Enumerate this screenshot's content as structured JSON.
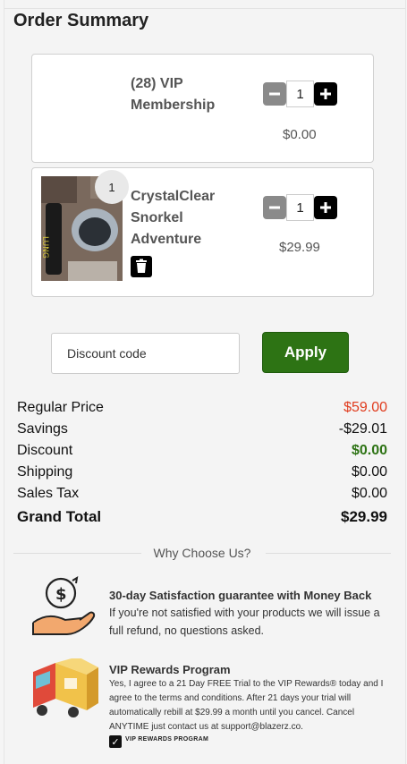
{
  "summary": {
    "title": "Order Summary"
  },
  "items": [
    {
      "name": "(28) VIP Membership",
      "quantity": "1",
      "price": "$0.00"
    },
    {
      "badge": "1",
      "name": "CrystalClear Snorkel Adventure",
      "quantity": "1",
      "price": "$29.99"
    }
  ],
  "discount": {
    "placeholder": "Discount code",
    "apply_label": "Apply"
  },
  "totals": {
    "regular_label": "Regular Price",
    "regular_value": "$59.00",
    "savings_label": "Savings",
    "savings_value": "-$29.01",
    "discount_label": "Discount",
    "discount_value": "$0.00",
    "shipping_label": "Shipping",
    "shipping_value": "$0.00",
    "tax_label": "Sales Tax",
    "tax_value": "$0.00",
    "grand_label": "Grand Total",
    "grand_value": "$29.99"
  },
  "why": {
    "heading": "Why Choose Us?",
    "guarantee_title": "30-day Satisfaction guarantee with Money Back",
    "guarantee_text": "If you're not satisfied with your products we will issue a full refund, no questions asked.",
    "vip_title": "VIP Rewards Program",
    "vip_text": "Yes, I agree to a 21 Day FREE Trial to the VIP Rewards® today and I agree to the terms and conditions. After 21 days your trial will automatically rebill at $29.99 a month until you cancel. Cancel ANYTIME just contact us at support@blazerz.co.",
    "vip_checkbox_label": "VIP REWARDS PROGRAM"
  },
  "colors": {
    "apply_bg": "#2d7314",
    "regular_price": "#e03c1e",
    "discount_value": "#2d7314"
  },
  "icons": [
    "minus-icon",
    "plus-icon",
    "trash-icon",
    "money-hand-icon",
    "delivery-truck-icon",
    "check-icon"
  ]
}
